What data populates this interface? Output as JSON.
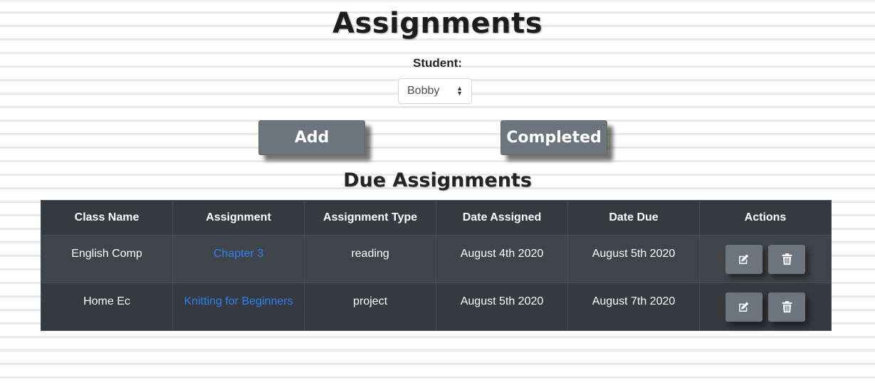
{
  "header": {
    "title": "Assignments",
    "student_label": "Student:",
    "student_selected": "Bobby"
  },
  "buttons": {
    "add": "Add",
    "completed": "Completed"
  },
  "section": {
    "title": "Due Assignments"
  },
  "table": {
    "columns": [
      "Class Name",
      "Assignment",
      "Assignment Type",
      "Date Assigned",
      "Date Due",
      "Actions"
    ],
    "rows": [
      {
        "class_name": "English Comp",
        "assignment": "Chapter 3",
        "type": "reading",
        "date_assigned": "August 4th 2020",
        "date_due": "August 5th 2020"
      },
      {
        "class_name": "Home Ec",
        "assignment": "Knitting for Beginners",
        "type": "project",
        "date_assigned": "August 5th 2020",
        "date_due": "August 7th 2020"
      }
    ]
  },
  "icons": {
    "edit": "edit-icon",
    "delete": "trash-icon",
    "select_caret": "caret-up-down-icon"
  },
  "colors": {
    "button_gray": "#6c757d",
    "table_dark": "#343a40",
    "link_blue": "#2f80ed"
  }
}
